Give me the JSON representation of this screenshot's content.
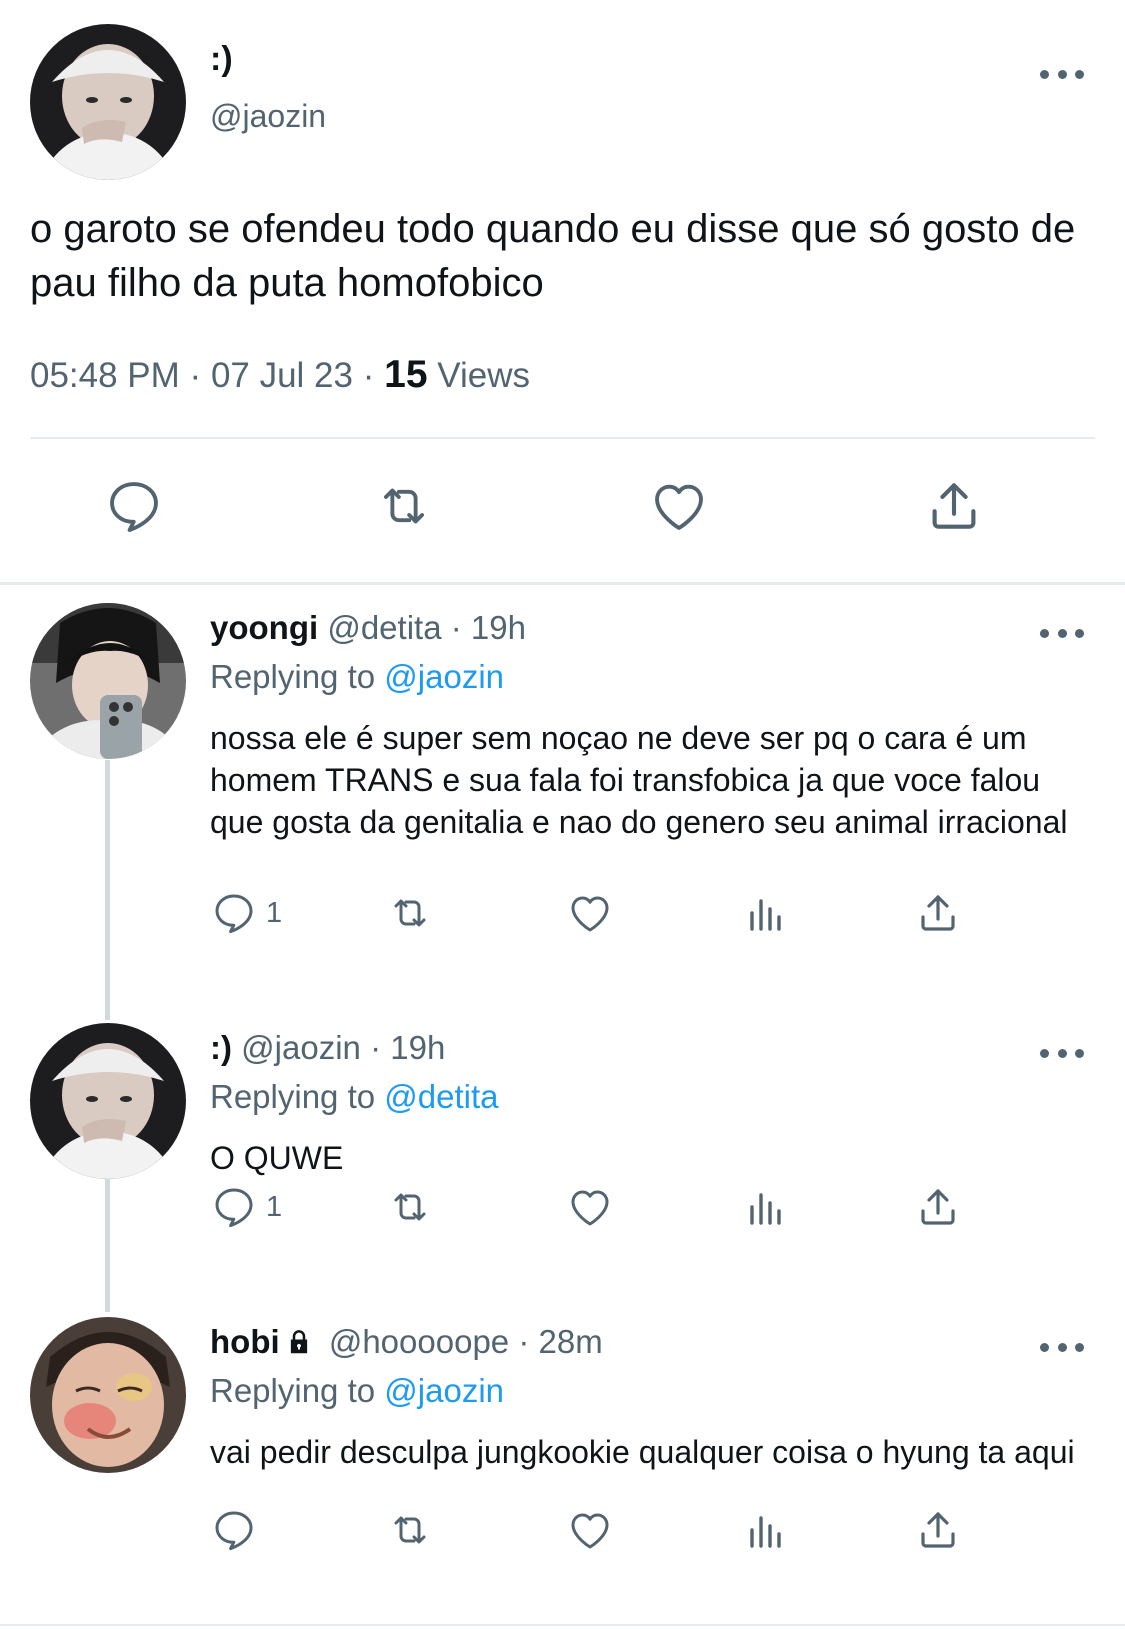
{
  "main_tweet": {
    "display_name": ":)",
    "handle": "@jaozin",
    "text": "o garoto se ofendeu todo quando eu disse que só gosto de pau filho da puta homofobico",
    "time": "05:48 PM",
    "date": "07 Jul 23",
    "views_count": "15",
    "views_label": "Views",
    "separator": "·"
  },
  "replies": [
    {
      "display_name": "yoongi",
      "handle": "@detita",
      "time": "19h",
      "replying_label": "Replying to",
      "replying_to": "@jaozin",
      "text": "nossa ele é super sem noçao ne deve ser pq o cara é um homem TRANS e sua fala foi transfobica ja que voce falou que gosta da genitalia e nao do genero seu animal irracional",
      "reply_count": "1"
    },
    {
      "display_name": ":)",
      "handle": "@jaozin",
      "time": "19h",
      "replying_label": "Replying to",
      "replying_to": "@detita",
      "text": "O QUWE",
      "reply_count": "1"
    },
    {
      "display_name": "hobi",
      "handle": "@hooooope",
      "time": "28m",
      "replying_label": "Replying to",
      "replying_to": "@jaozin",
      "text": "vai pedir desculpa jungkookie qualquer coisa o hyung ta aqui",
      "reply_count": ""
    }
  ],
  "icons": {
    "reply": "speech-bubble-icon",
    "retweet": "retweet-icon",
    "like": "heart-icon",
    "views": "bar-chart-icon",
    "share": "share-icon",
    "more": "ellipsis-icon",
    "protected": "lock-icon"
  },
  "colors": {
    "text": "#0f1419",
    "muted": "#536471",
    "link": "#1d9bf0",
    "divider": "#e7ebee"
  }
}
